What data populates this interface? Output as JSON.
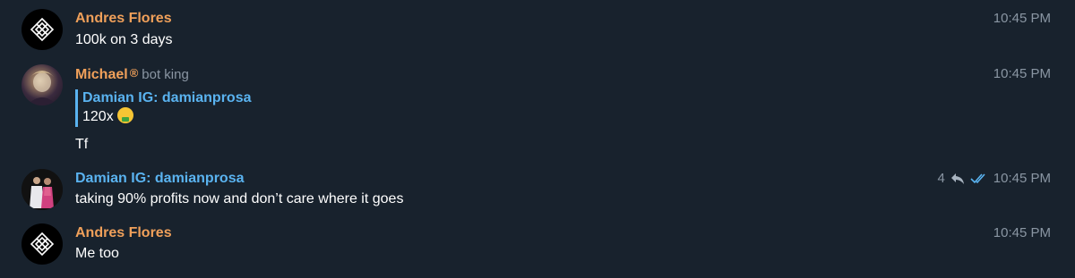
{
  "messages": [
    {
      "sender": "Andres Flores",
      "text": "100k on 3 days",
      "time": "10:45 PM",
      "avatar": "logo-icon"
    },
    {
      "sender": "Michael",
      "rank_symbol": "®",
      "rank": "bot king",
      "quote": {
        "name": "Damian IG: damianprosa",
        "text": "120x",
        "emoji": "money-mouth-face-icon"
      },
      "text": "Tf",
      "time": "10:45 PM",
      "avatar": "photo"
    },
    {
      "sender": "Damian IG: damianprosa",
      "text": "taking 90% profits now and don’t care where it goes",
      "replies": "4",
      "reply_icon": "reply-arrow-icon",
      "read_icon": "double-check-icon",
      "time": "10:45 PM",
      "avatar": "photo"
    },
    {
      "sender": "Andres Flores",
      "text": "Me too",
      "time": "10:45 PM",
      "avatar": "logo-icon"
    }
  ],
  "colors": {
    "background": "#18222d",
    "sender_orange": "#f0a05a",
    "sender_blue": "#5ab3f0",
    "muted": "#8a96a3"
  }
}
